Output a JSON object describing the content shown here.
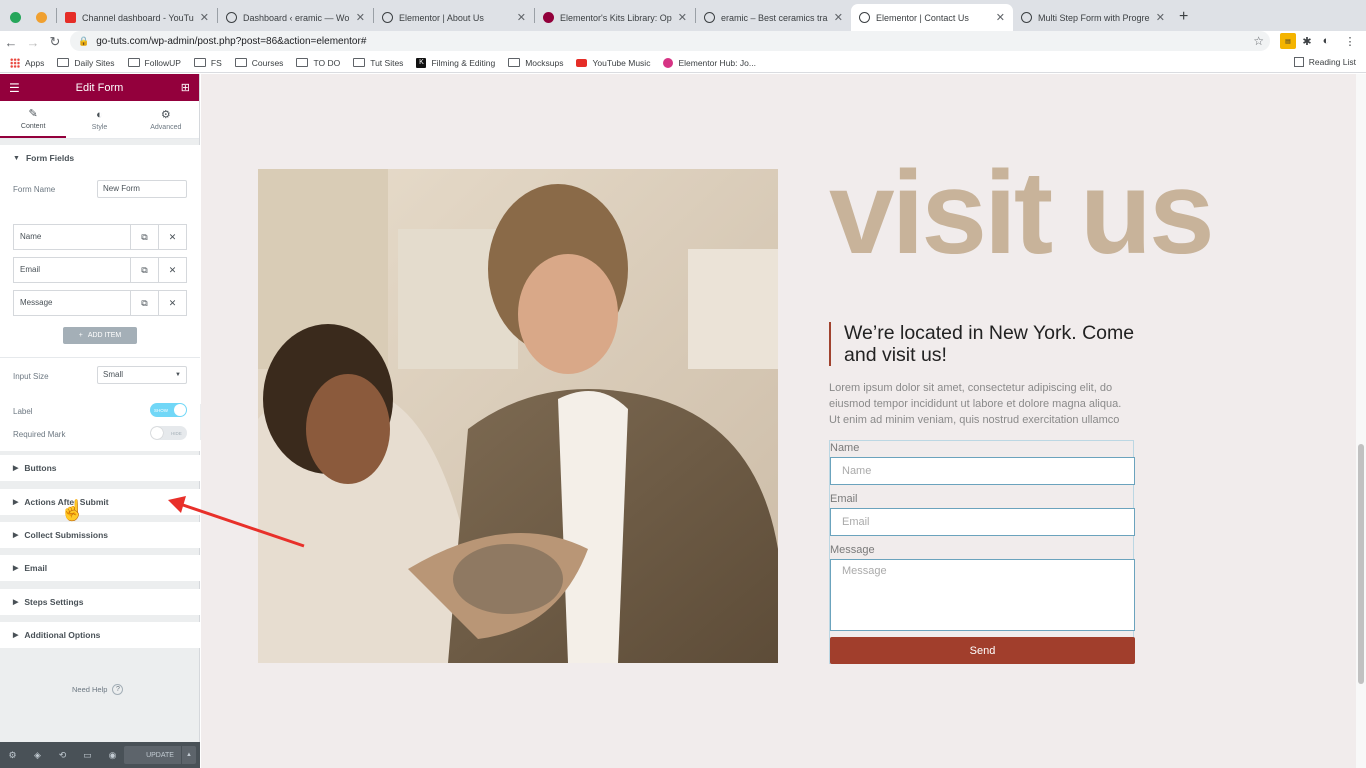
{
  "browser": {
    "tabs": [
      {
        "title": "",
        "favicon_color": "#26a65b"
      },
      {
        "title": "",
        "favicon_color": "#f0a030"
      },
      {
        "title": "Channel dashboard - YouTube",
        "favicon_color": "#e52d27"
      },
      {
        "title": "Dashboard ‹ eramic — WordPress",
        "favicon_color": "#3c4043"
      },
      {
        "title": "Elementor | About Us",
        "favicon_color": "#3c4043"
      },
      {
        "title": "Elementor's Kits Library: Optimized",
        "favicon_color": "#92003b"
      },
      {
        "title": "eramic – Best ceramics training",
        "favicon_color": "#3c4043"
      },
      {
        "title": "Elementor | Contact Us",
        "favicon_color": "#3c4043",
        "active": true
      },
      {
        "title": "Multi Step Form with Progress",
        "favicon_color": "#3c4043"
      }
    ],
    "url": "go-tuts.com/wp-admin/post.php?post=86&action=elementor#",
    "bookmarks": [
      "Apps",
      "Daily Sites",
      "FollowUP",
      "FS",
      "Courses",
      "TO DO",
      "Tut Sites",
      "Filming & Editing",
      "Mocksups",
      "YouTube Music",
      "Elementor Hub: Jo..."
    ],
    "reading_list": "Reading List"
  },
  "sidebar": {
    "title": "Edit Form",
    "tabs": [
      "Content",
      "Style",
      "Advanced"
    ],
    "form_fields_heading": "Form Fields",
    "form_name_label": "Form Name",
    "form_name_value": "New Form",
    "fields": [
      "Name",
      "Email",
      "Message"
    ],
    "add_item": "ADD ITEM",
    "input_size_label": "Input Size",
    "input_size_value": "Small",
    "label_label": "Label",
    "label_toggle": "SHOW",
    "required_label": "Required Mark",
    "required_toggle": "HIDE",
    "sections": [
      "Buttons",
      "Actions After Submit",
      "Collect Submissions",
      "Email",
      "Steps Settings",
      "Additional Options"
    ],
    "need_help": "Need Help",
    "update": "UPDATE"
  },
  "page": {
    "headline": "visit us",
    "subhead": "We’re located in New York. Come and visit us!",
    "lorem": "Lorem ipsum dolor sit amet, consectetur adipiscing elit, do eiusmod tempor incididunt ut labore et dolore magna aliqua. Ut enim ad minim veniam, quis nostrud exercitation ullamco",
    "form": {
      "name_label": "Name",
      "name_placeholder": "Name",
      "email_label": "Email",
      "email_placeholder": "Email",
      "message_label": "Message",
      "message_placeholder": "Message",
      "send": "Send"
    }
  },
  "colors": {
    "accent": "#93003c",
    "headline": "#c8b39a",
    "button": "#a13e2c"
  }
}
